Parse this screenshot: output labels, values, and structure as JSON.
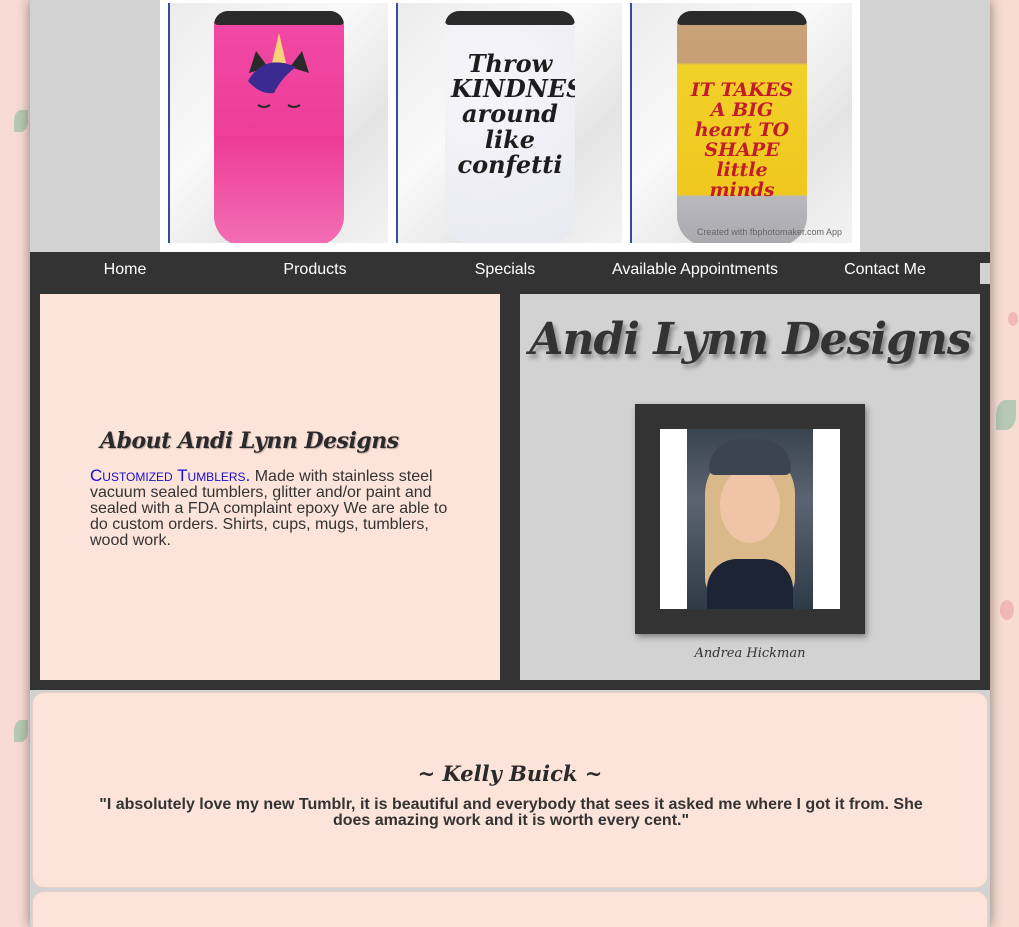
{
  "banner": {
    "tumblers": [
      {
        "text": "",
        "style": "pink unicorn glitter"
      },
      {
        "text": "Throw KINDNESS around like confetti"
      },
      {
        "text": "IT TAKES A BIG heart TO SHAPE little minds"
      }
    ],
    "watermark": "Created with fbphotomaker.com App"
  },
  "nav": {
    "items": [
      "Home",
      "Products",
      "Specials",
      "Available Appointments",
      "Contact Me"
    ]
  },
  "about": {
    "title": "About Andi Lynn Designs",
    "highlight": "Customized Tumblers.",
    "body": " Made with stainless steel vacuum sealed tumblers, glitter and/or paint and sealed with a FDA complaint epoxy We are able to do custom orders. Shirts, cups, mugs, tumblers, wood work."
  },
  "profile": {
    "brand": "Andi Lynn Designs",
    "caption": "Andrea Hickman"
  },
  "testimonial": {
    "name": "~ Kelly Buick ~",
    "quote": "\"I absolutely love my new Tumblr, it is beautiful and everybody that sees it asked me where I got it from. She does amazing work and it is worth every cent.\""
  },
  "colors": {
    "page_bg": "#f8dcd3",
    "panel_gray": "#d2d2d2",
    "dark": "#333333",
    "pink_panel": "#fde4db",
    "link_blue": "#1a0dcc"
  }
}
